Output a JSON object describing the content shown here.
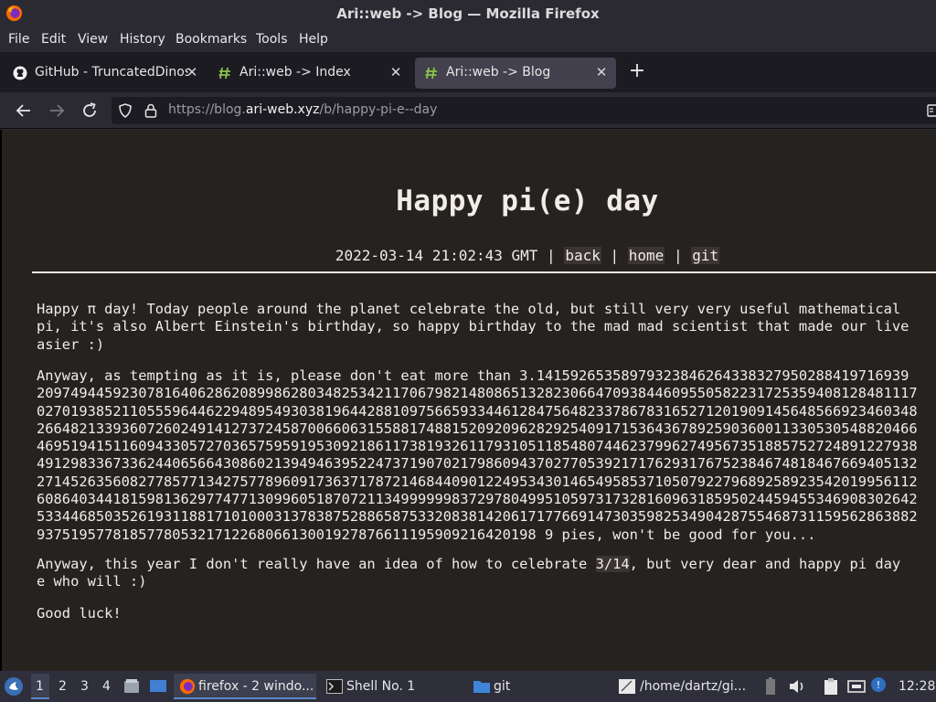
{
  "window": {
    "title": "Ari::web -> Blog — Mozilla Firefox"
  },
  "menu": [
    "File",
    "Edit",
    "View",
    "History",
    "Bookmarks",
    "Tools",
    "Help"
  ],
  "tabs": [
    {
      "label": "GitHub - TruncatedDinos",
      "icon": "github-icon",
      "active": false
    },
    {
      "label": "Ari::web -> Index",
      "icon": "hash-icon",
      "active": false
    },
    {
      "label": "Ari::web -> Blog",
      "icon": "hash-icon",
      "active": true
    }
  ],
  "url": {
    "prefix": "https://blog.",
    "domain": "ari-web.xyz",
    "path": "/b/happy-pi-e--day"
  },
  "post": {
    "title": "Happy pi(e) day",
    "date": "2022-03-14 21:02:43 GMT",
    "sep": "|",
    "links": [
      "back",
      "home",
      "git"
    ],
    "p1": [
      "Happy π day! Today people around the planet celebrate the old, but still very very useful mathematical",
      "pi, it's also Albert Einstein's birthday, so happy birthday to the mad mad scientist that made our live",
      "asier :)"
    ],
    "p2": [
      "Anyway, as tempting as it is, please don't eat more than 3.14159265358979323846264338327950288419716939",
      "20974944592307816406286208998628034825342117067982148086513282306647093844609550582231725359408128481117",
      "02701938521105559644622948954930381964428810975665933446128475648233786783165271201909145648566923460348",
      "26648213393607260249141273724587006606315588174881520920962829254091715364367892590360011330530548820466",
      "46951941511609433057270365759591953092186117381932611793105118548074462379962749567351885752724891227938",
      "49129833673362440656643086021394946395224737190702179860943702770539217176293176752384674818467669405132",
      "27145263560827785771342757789609173637178721468440901224953430146549585371050792279689258923542019956112",
      "60864034418159813629774771309960518707211349999998372978049951059731732816096318595024459455346908302642",
      "53344685035261931188171010003137838752886587533208381420617177669147303598253490428755468731159562863882",
      "93751957781857780532171226806613001927876611195909216420198 9 pies, won't be good for you..."
    ],
    "p3a": "Anyway, this year I don't really have an idea of how to celebrate ",
    "p3hl": "3/14",
    "p3b": ", but very dear and happy pi day",
    "p3c": "e who will :)",
    "p4": "Good luck!"
  },
  "taskbar": {
    "workspaces": [
      "1",
      "2",
      "3",
      "4"
    ],
    "tasks": [
      "firefox - 2 windo...",
      "Shell No. 1",
      "git",
      "/home/dartz/gi..."
    ],
    "clock": "12:28"
  }
}
